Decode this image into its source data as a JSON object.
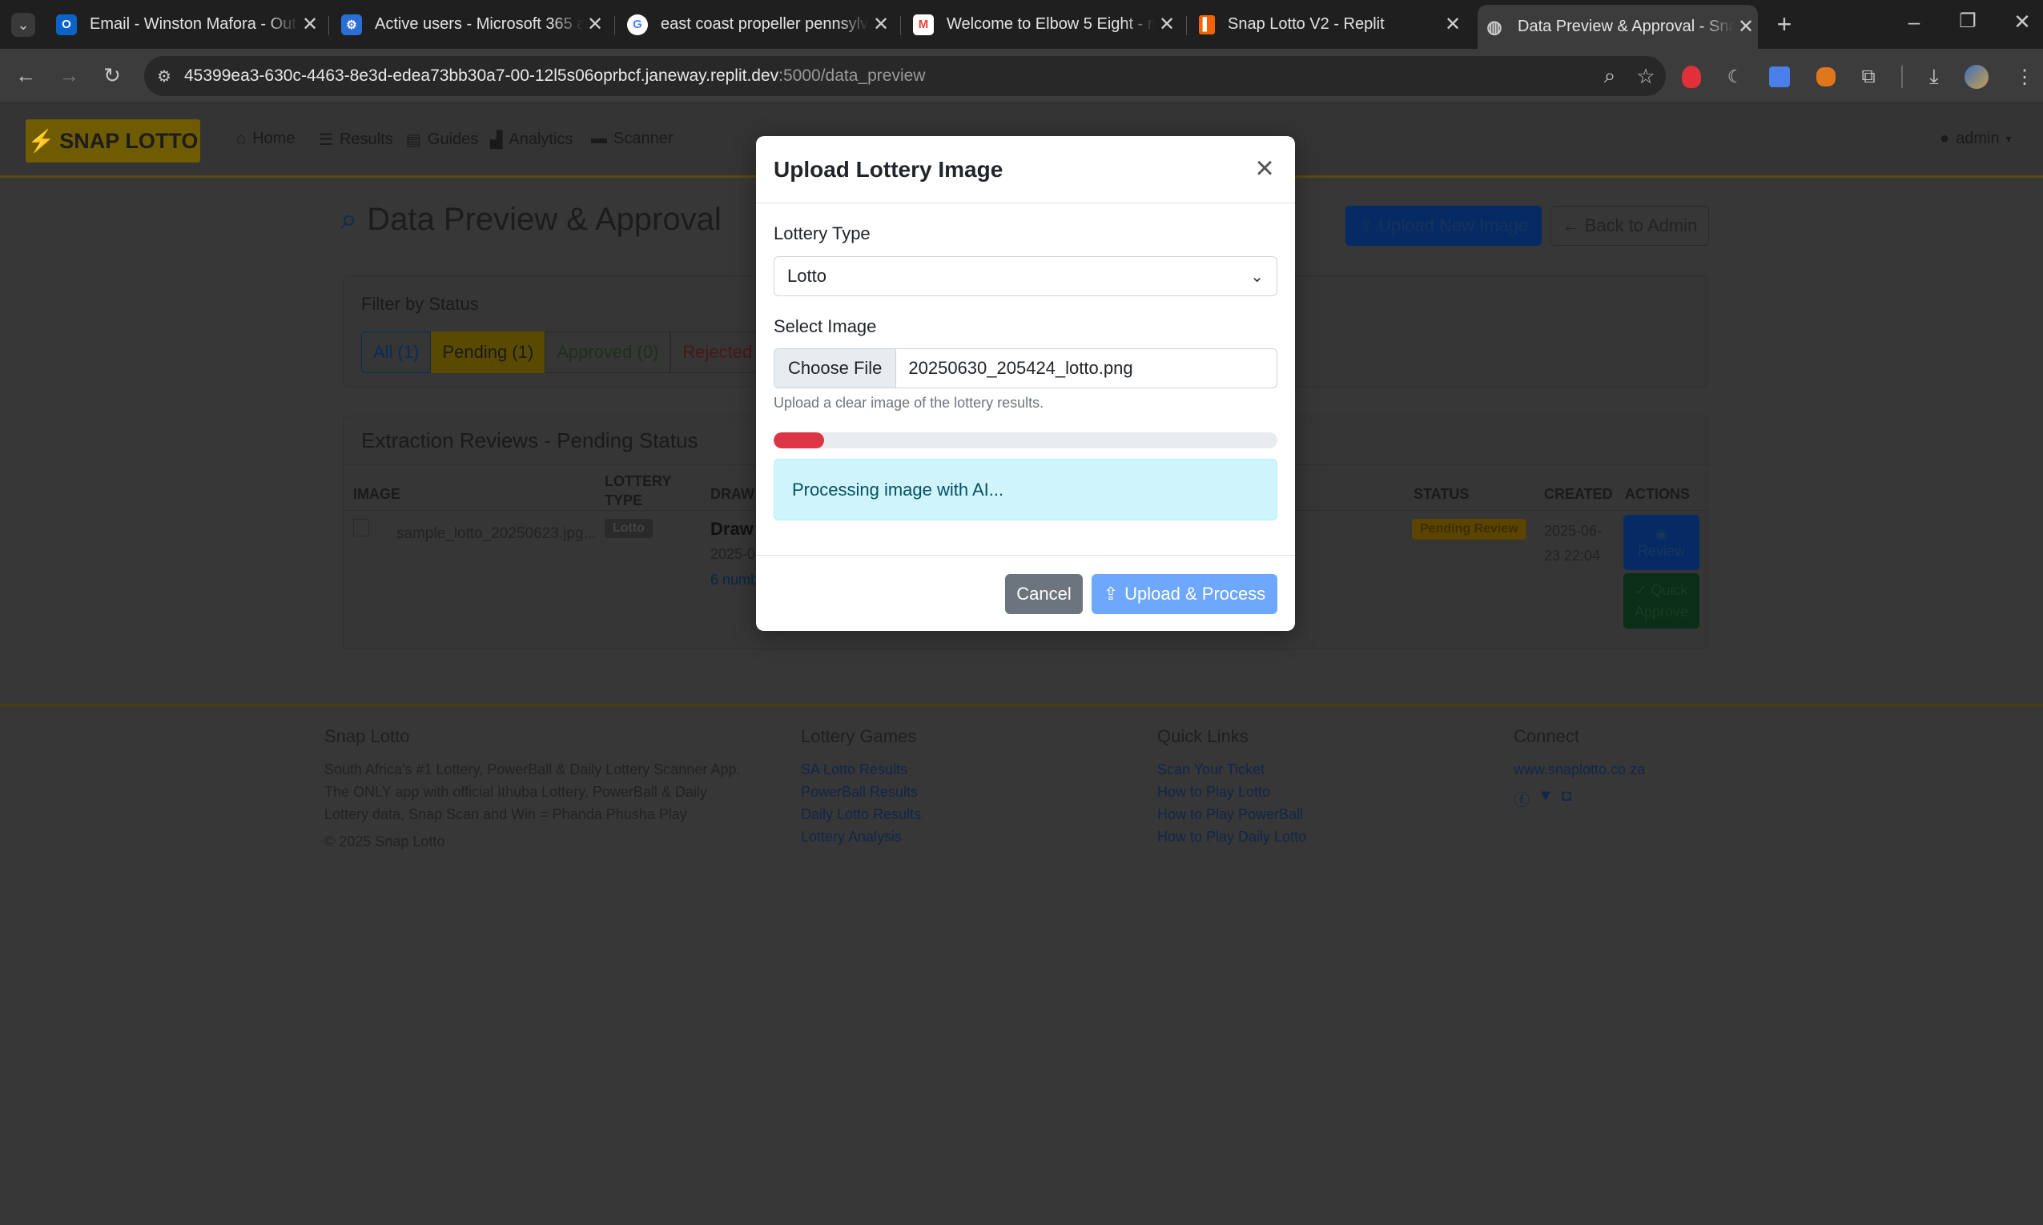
{
  "browser": {
    "tabs": [
      {
        "title": "Email - Winston Mafora - Outlo",
        "icon": "outlook-icon"
      },
      {
        "title": "Active users - Microsoft 365 ad",
        "icon": "microsoft365-admin-icon"
      },
      {
        "title": "east coast propeller pennsylvan",
        "icon": "google-icon"
      },
      {
        "title": "Welcome to Elbow 5 Eight - mr",
        "icon": "gmail-icon"
      },
      {
        "title": "Snap Lotto V2 - Replit",
        "icon": "replit-icon"
      },
      {
        "title": "Data Preview & Approval - Snap",
        "icon": "globe-icon",
        "active": true
      }
    ],
    "url_main": "45399ea3-630c-4463-8e3d-edea73bb30a7-00-12l5s06oprbcf.janeway.replit.dev",
    "url_rest": ":5000/data_preview"
  },
  "site": {
    "brand": "SNAP LOTTO",
    "nav": [
      "Home",
      "Results",
      "Guides",
      "Analytics",
      "Scanner"
    ],
    "user": "admin",
    "page_title": "Data Preview & Approval",
    "upload_new_label": "Upload New Image",
    "back_admin_label": "Back to Admin",
    "filter_heading": "Filter by Status",
    "filters": [
      "All (1)",
      "Pending (1)",
      "Approved (0)",
      "Rejected ("
    ],
    "reviews_heading": "Extraction Reviews - Pending Status",
    "columns": [
      "IMAGE",
      "LOTTERY TYPE",
      "DRAW",
      "STATUS",
      "CREATED",
      "ACTIONS"
    ],
    "row": {
      "image_alt": "sample_lotto_20250623.jpg...",
      "type_badge": "Lotto",
      "draw": "Draw",
      "draw_date": "2025-0",
      "draw_numbers": "6 numb",
      "status_badge": "Pending Review",
      "created_line1": "2025-06-",
      "created_line2": "23 22:04",
      "review_label": "Review",
      "quick_approve_line1": "Quick",
      "quick_approve_line2": "Approve"
    }
  },
  "footer": {
    "about_title": "Snap Lotto",
    "about_text": [
      "South Africa's #1 Lottery, PowerBall & Daily Lottery Scanner App.",
      "The ONLY app with official Ithuba Lottery, PowerBall & Daily",
      "Lottery data, Snap Scan and Win = Phanda Phusha Play"
    ],
    "copyright": "© 2025 Snap Lotto",
    "games_title": "Lottery Games",
    "games": [
      "SA Lotto Results",
      "PowerBall Results",
      "Daily Lotto Results",
      "Lottery Analysis"
    ],
    "links_title": "Quick Links",
    "links": [
      "Scan Your Ticket",
      "How to Play Lotto",
      "How to Play PowerBall",
      "How to Play Daily Lotto"
    ],
    "connect_title": "Connect",
    "website": "www.snaplotto.co.za"
  },
  "modal": {
    "title": "Upload Lottery Image",
    "lottery_type_label": "Lottery Type",
    "lottery_type_value": "Lotto",
    "select_image_label": "Select Image",
    "choose_file_label": "Choose File",
    "file_name": "20250630_205424_lotto.png",
    "help_text": "Upload a clear image of the lottery results.",
    "progress_fraction": 0.1,
    "status_text": "Processing image with AI...",
    "cancel_label": "Cancel",
    "submit_label": "Upload & Process"
  },
  "colors": {
    "danger": "#dc3545",
    "primary": "#0d6efd",
    "secondary": "#6c757d",
    "info_bg": "#cff4fc"
  }
}
